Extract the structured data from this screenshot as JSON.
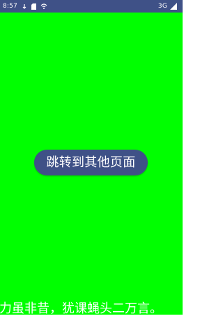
{
  "status_bar": {
    "time": "8:57",
    "network": "3G",
    "background_color": "#3f5187",
    "icons": [
      "gesture-icon",
      "sd-card-icon",
      "wifi-icon",
      "signal-icon"
    ]
  },
  "main": {
    "background_color": "#00ff00",
    "button_label": "跳转到其他页面",
    "button_color": "#3f5187"
  },
  "bottom_text": {
    "part_1": "力虽非昔，",
    "part_2": "犹课蝇头二万言。"
  }
}
